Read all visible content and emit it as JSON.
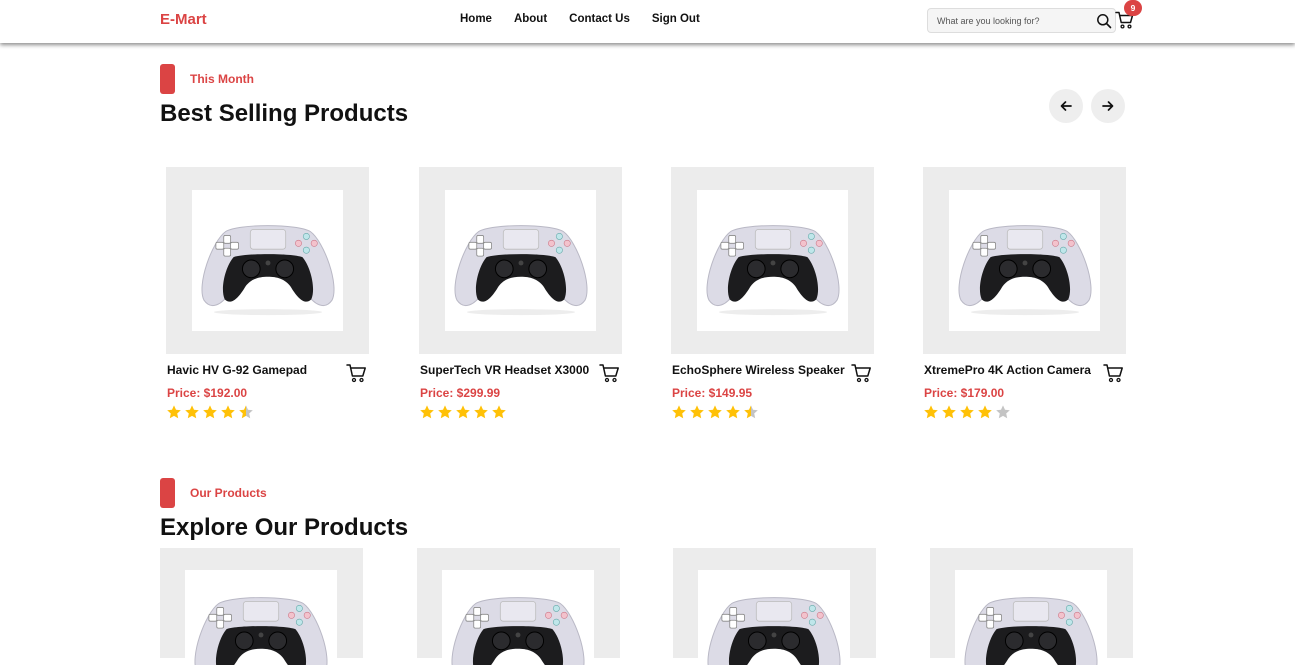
{
  "header": {
    "brand": "E-Mart",
    "nav": [
      "Home",
      "About",
      "Contact Us",
      "Sign Out"
    ],
    "search_placeholder": "What are you looking for?",
    "cart_count": "9"
  },
  "best_selling": {
    "label": "This Month",
    "title": "Best Selling Products",
    "products": [
      {
        "name": "Havic HV G-92 Gamepad",
        "price": "Price: $192.00",
        "rating": 4.5
      },
      {
        "name": "SuperTech VR Headset X3000",
        "price": "Price: $299.99",
        "rating": 5
      },
      {
        "name": "EchoSphere Wireless Speaker",
        "price": "Price: $149.95",
        "rating": 4.5
      },
      {
        "name": "XtremePro 4K Action Camera",
        "price": "Price: $179.00",
        "rating": 4
      }
    ]
  },
  "explore": {
    "label": "Our Products",
    "title": "Explore Our Products"
  },
  "colors": {
    "accent": "#db4444",
    "star": "#ffc107",
    "star_empty": "#c4c4c4",
    "card_bg": "#ececec"
  },
  "icons": {
    "search": "search-icon",
    "cart": "cart-icon",
    "prev": "arrow-left-icon",
    "next": "arrow-right-icon",
    "star": "star-icon"
  }
}
